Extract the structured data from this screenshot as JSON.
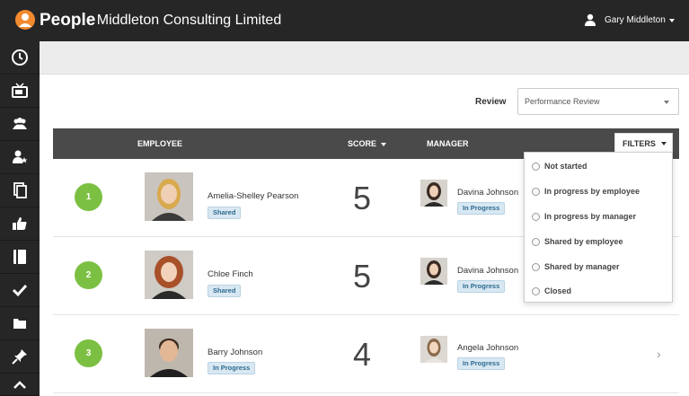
{
  "header": {
    "brand": "People",
    "company": "- Middleton Consulting Limited",
    "user_name": "Gary Middleton"
  },
  "sidebar": {
    "items": [
      {
        "icon": "dashboard-icon"
      },
      {
        "icon": "tv-icon"
      },
      {
        "icon": "people-icon"
      },
      {
        "icon": "user-star-icon"
      },
      {
        "icon": "documents-icon"
      },
      {
        "icon": "thumbs-up-icon"
      },
      {
        "icon": "book-icon"
      },
      {
        "icon": "checkmark-icon"
      },
      {
        "icon": "folder-icon"
      },
      {
        "icon": "pin-icon"
      }
    ]
  },
  "review": {
    "label": "Review",
    "selected": "Performance Review"
  },
  "table": {
    "columns": {
      "employee": "EMPLOYEE",
      "score": "SCORE",
      "manager": "MANAGER",
      "filters": "FILTERS"
    },
    "rows": [
      {
        "rank": "1",
        "name": "Amelia-Shelley Pearson",
        "status": "Shared",
        "score": "5",
        "manager": "Davina Johnson",
        "manager_status": "In Progress"
      },
      {
        "rank": "2",
        "name": "Chloe Finch",
        "status": "Shared",
        "score": "5",
        "manager": "Davina Johnson",
        "manager_status": "In Progress"
      },
      {
        "rank": "3",
        "name": "Barry Johnson",
        "status": "In Progress",
        "score": "4",
        "manager": "Angela Johnson",
        "manager_status": "In Progress"
      }
    ]
  },
  "filters": {
    "options": [
      "Not started",
      "In progress by employee",
      "In progress by manager",
      "Shared by employee",
      "Shared by manager",
      "Closed"
    ]
  },
  "colors": {
    "accent_green": "#7cc043",
    "header_dark": "#262626",
    "badge_blue": "#d8e8f3"
  }
}
